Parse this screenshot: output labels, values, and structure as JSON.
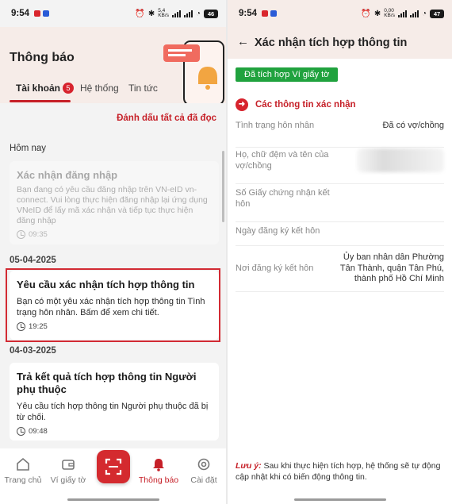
{
  "left": {
    "status": {
      "time": "9:54",
      "net_speed": "5,4\nKB/s",
      "battery": "46"
    },
    "title": "Thông báo",
    "tabs": [
      {
        "label": "Tài khoản",
        "badge": "5"
      },
      {
        "label": "Hệ thống"
      },
      {
        "label": "Tin tức"
      }
    ],
    "mark_all_read": "Đánh dấu tất cả đã đọc",
    "sections": [
      {
        "date": "Hôm nay"
      },
      {
        "date": "05-04-2025"
      },
      {
        "date": "04-03-2025"
      }
    ],
    "notifications": [
      {
        "title": "Xác nhận đăng nhập",
        "body": "Bạn đang có yêu cầu đăng nhập trên VN-eID vn-connect. Vui lòng thực hiện đăng nhập lại ứng dụng VNeID để lấy mã xác nhận và tiếp tục thực hiện đăng nhập",
        "time": "09:35"
      },
      {
        "title": "Yêu cầu xác nhận tích hợp thông tin",
        "body": "Bạn có một yêu xác nhận tích hợp thông tin Tình trạng hôn nhân. Bấm để xem chi tiết.",
        "time": "19:25"
      },
      {
        "title": "Trả kết quả tích hợp thông tin Người phụ thuộc",
        "body": "Yêu cầu tích hợp thông tin Người phụ thuộc đã bị từ chối.",
        "time": "09:48"
      }
    ],
    "nav": [
      {
        "label": "Trang chủ",
        "icon": "home-icon"
      },
      {
        "label": "Ví giấy tờ",
        "icon": "wallet-icon"
      },
      {
        "label": "",
        "icon": "qr-scan-icon"
      },
      {
        "label": "Thông báo",
        "icon": "bell-icon"
      },
      {
        "label": "Cài đặt",
        "icon": "gear-icon"
      }
    ]
  },
  "right": {
    "status": {
      "time": "9:54",
      "net_speed": "0,00\nKB/s",
      "battery": "47"
    },
    "title": "Xác nhận tích hợp thông tin",
    "badge": "Đã tích hợp Ví giấy tờ",
    "section_title": "Các thông tin xác nhận",
    "rows": [
      {
        "label": "Tình trạng hôn nhân",
        "value": "Đã có vợ/chồng"
      },
      {
        "label": "Họ, chữ đệm và tên của vợ/chồng",
        "value": ""
      },
      {
        "label": "Số Giấy chứng nhận kết hôn",
        "value": ""
      },
      {
        "label": "Ngày đăng ký kết hôn",
        "value": ""
      },
      {
        "label": "Nơi đăng ký kết hôn",
        "value": "Ủy ban nhân dân Phường Tân Thành, quận Tân Phú, thành phố Hồ Chí Minh"
      }
    ],
    "note_label": "Lưu ý:",
    "note_text": " Sau khi thực hiện tích hợp, hệ thống sẽ tự động cập nhật khi có biến động thông tin."
  },
  "colors": {
    "accent": "#c62028",
    "success": "#20a23e",
    "header_bg": "#f6ece8"
  }
}
